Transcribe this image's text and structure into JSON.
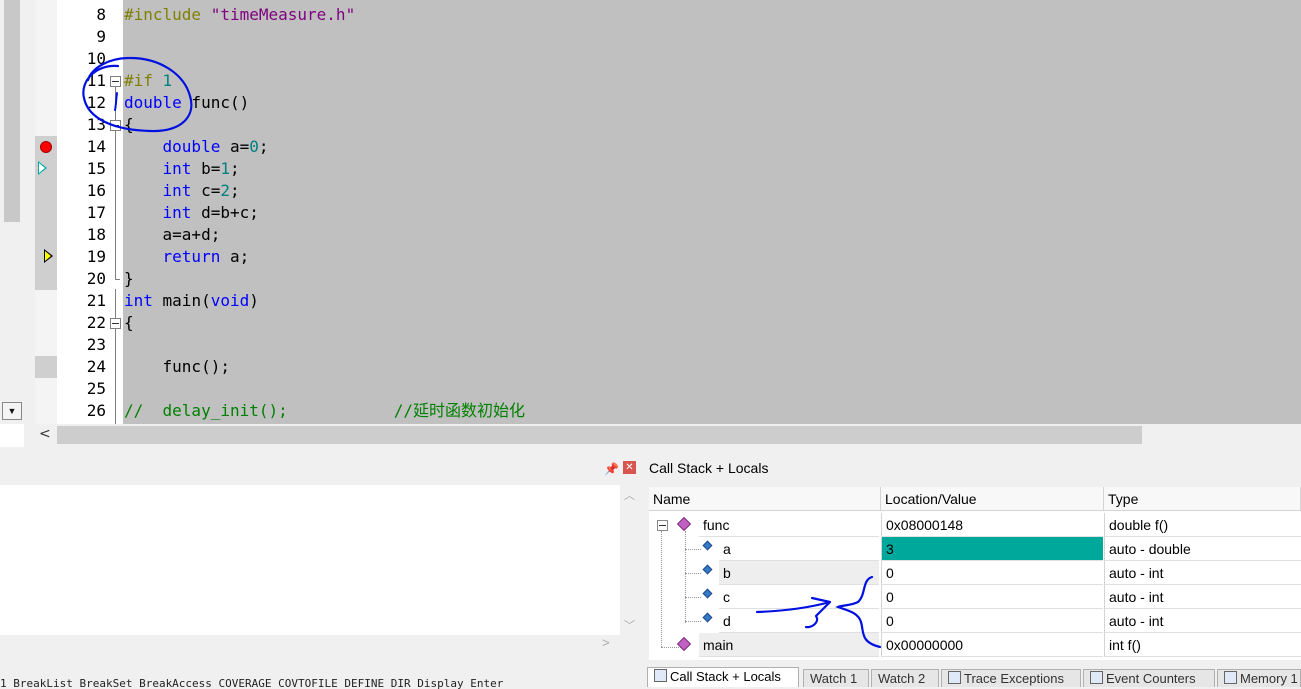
{
  "editor": {
    "lines": [
      {
        "no": "8",
        "tokens": [
          {
            "t": "#include ",
            "c": "pp"
          },
          {
            "t": "\"timeMeasure.h\"",
            "c": "str"
          }
        ]
      },
      {
        "no": "9",
        "tokens": []
      },
      {
        "no": "10",
        "tokens": []
      },
      {
        "no": "11",
        "tokens": [
          {
            "t": "#if ",
            "c": "pp"
          },
          {
            "t": "1",
            "c": "num"
          }
        ]
      },
      {
        "no": "12",
        "tokens": [
          {
            "t": "double",
            "c": "kw"
          },
          {
            "t": " func()",
            "c": ""
          }
        ]
      },
      {
        "no": "13",
        "tokens": [
          {
            "t": "{",
            "c": ""
          }
        ]
      },
      {
        "no": "14",
        "tokens": [
          {
            "t": "    ",
            "c": ""
          },
          {
            "t": "double",
            "c": "kw"
          },
          {
            "t": " a=",
            "c": ""
          },
          {
            "t": "0",
            "c": "num"
          },
          {
            "t": ";",
            "c": ""
          }
        ]
      },
      {
        "no": "15",
        "tokens": [
          {
            "t": "    ",
            "c": ""
          },
          {
            "t": "int",
            "c": "kw"
          },
          {
            "t": " b=",
            "c": ""
          },
          {
            "t": "1",
            "c": "num"
          },
          {
            "t": ";",
            "c": ""
          }
        ]
      },
      {
        "no": "16",
        "tokens": [
          {
            "t": "    ",
            "c": ""
          },
          {
            "t": "int",
            "c": "kw"
          },
          {
            "t": " c=",
            "c": ""
          },
          {
            "t": "2",
            "c": "num"
          },
          {
            "t": ";",
            "c": ""
          }
        ]
      },
      {
        "no": "17",
        "tokens": [
          {
            "t": "    ",
            "c": ""
          },
          {
            "t": "int",
            "c": "kw"
          },
          {
            "t": " d=b+c;",
            "c": ""
          }
        ]
      },
      {
        "no": "18",
        "tokens": [
          {
            "t": "    a=a+d;",
            "c": ""
          }
        ]
      },
      {
        "no": "19",
        "tokens": [
          {
            "t": "    ",
            "c": ""
          },
          {
            "t": "return",
            "c": "kw"
          },
          {
            "t": " a;",
            "c": ""
          }
        ]
      },
      {
        "no": "20",
        "tokens": [
          {
            "t": "}",
            "c": ""
          }
        ]
      },
      {
        "no": "21",
        "tokens": [
          {
            "t": "int",
            "c": "kw"
          },
          {
            "t": " main(",
            "c": ""
          },
          {
            "t": "void",
            "c": "kw"
          },
          {
            "t": ")",
            "c": ""
          }
        ]
      },
      {
        "no": "22",
        "tokens": [
          {
            "t": "{",
            "c": ""
          }
        ]
      },
      {
        "no": "23",
        "tokens": []
      },
      {
        "no": "24",
        "tokens": [
          {
            "t": "    func();",
            "c": ""
          }
        ]
      },
      {
        "no": "25",
        "tokens": []
      },
      {
        "no": "26",
        "tokens": [
          {
            "t": "//  delay_init();           //延时函数初始化",
            "c": "cm"
          }
        ]
      }
    ]
  },
  "bottom_left": {
    "command_text": "1 BreakList BreakSet BreakAccess COVERAGE COVTOFILE DEFINE DIR Display Enter"
  },
  "callstack": {
    "title": "Call Stack + Locals",
    "columns": [
      "Name",
      "Location/Value",
      "Type"
    ],
    "rows": [
      {
        "name": "func",
        "value": "0x08000148",
        "type": "double f()"
      },
      {
        "name": "a",
        "value": "3",
        "type": "auto - double"
      },
      {
        "name": "b",
        "value": "0",
        "type": "auto - int"
      },
      {
        "name": "c",
        "value": "0",
        "type": "auto - int"
      },
      {
        "name": "d",
        "value": "0",
        "type": "auto - int"
      },
      {
        "name": "main",
        "value": "0x00000000",
        "type": "int f()"
      }
    ],
    "tabs": [
      "Call Stack + Locals",
      "Watch 1",
      "Watch 2",
      "Trace Exceptions",
      "Event Counters",
      "Memory 1"
    ]
  },
  "colors": {
    "highlight": "#00a89c",
    "annotation": "#0010e0",
    "breakpoint": "#ff0000",
    "code_background": "#c0c0c0"
  }
}
